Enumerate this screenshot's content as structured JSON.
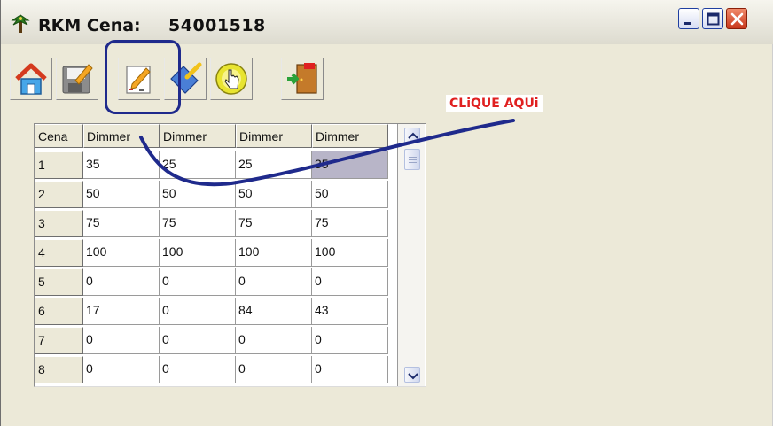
{
  "window": {
    "title_label": "RKM Cena:",
    "title_value": "54001518",
    "icons": [
      "app-icon",
      "minimize-icon",
      "maximize-icon",
      "close-icon"
    ]
  },
  "toolbar": {
    "buttons": [
      {
        "name": "home-button",
        "icon": "home-icon"
      },
      {
        "name": "save-button",
        "icon": "floppy-disk-icon"
      },
      {
        "name": "edit-button",
        "icon": "edit-pencil-icon"
      },
      {
        "name": "clear-button",
        "icon": "brush-icon"
      },
      {
        "name": "select-button",
        "icon": "hand-pointer-icon"
      },
      {
        "name": "exit-button",
        "icon": "exit-door-icon"
      }
    ]
  },
  "annotation": {
    "text": "CLiQUE AQUi",
    "color": "#e02020",
    "arrow_color": "#1f2a8c"
  },
  "grid": {
    "columns": [
      "Cena",
      "Dimmer",
      "Dimmer",
      "Dimmer",
      "Dimmer"
    ],
    "rows": [
      {
        "cena": "1",
        "values": [
          "35",
          "25",
          "25",
          "35"
        ]
      },
      {
        "cena": "2",
        "values": [
          "50",
          "50",
          "50",
          "50"
        ]
      },
      {
        "cena": "3",
        "values": [
          "75",
          "75",
          "75",
          "75"
        ]
      },
      {
        "cena": "4",
        "values": [
          "100",
          "100",
          "100",
          "100"
        ]
      },
      {
        "cena": "5",
        "values": [
          "0",
          "0",
          "0",
          "0"
        ]
      },
      {
        "cena": "6",
        "values": [
          "17",
          "0",
          "84",
          "43"
        ]
      },
      {
        "cena": "7",
        "values": [
          "0",
          "0",
          "0",
          "0"
        ]
      },
      {
        "cena": "8",
        "values": [
          "0",
          "0",
          "0",
          "0"
        ]
      }
    ],
    "selected_cell": {
      "row": 0,
      "col": 3
    }
  },
  "colors": {
    "window_bg": "#ece9d8",
    "highlight_border": "#1f2a8c",
    "selected_cell": "#b8b5c8"
  }
}
